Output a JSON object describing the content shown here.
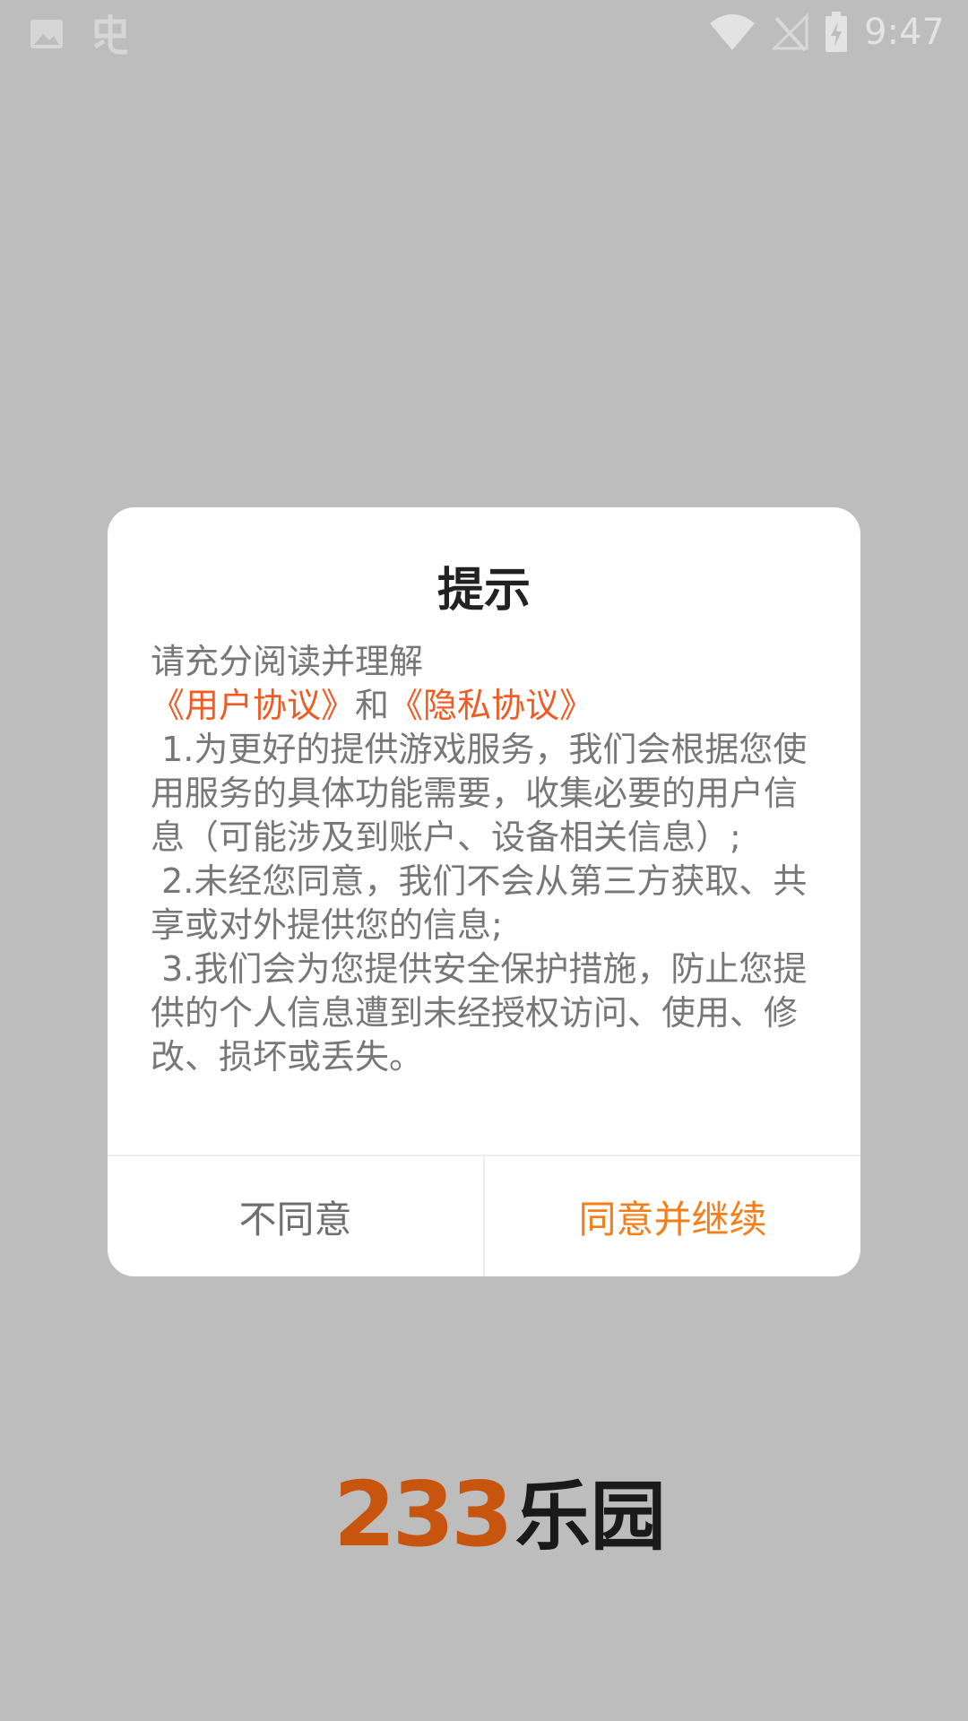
{
  "status_bar": {
    "time": "9:47",
    "icons_left": [
      "image-icon",
      "app-notification-icon"
    ],
    "icons_right": [
      "wifi-icon",
      "no-signal-icon",
      "battery-charging-icon"
    ]
  },
  "dialog": {
    "title": "提示",
    "intro": "请充分阅读并理解",
    "link_user": "《用户协议》",
    "link_and": "和",
    "link_privacy": "《隐私协议》",
    "items": [
      " 1.为更好的提供游戏服务，我们会根据您使用服务的具体功能需要，收集必要的用户信息（可能涉及到账户、设备相关信息）;",
      " 2.未经您同意，我们不会从第三方获取、共享或对外提供您的信息;",
      " 3.我们会为您提供安全保护措施，防止您提供的个人信息遭到未经授权访问、使用、修改、损坏或丢失。"
    ],
    "disagree_label": "不同意",
    "agree_label": "同意并继续"
  },
  "logo": {
    "number": "233",
    "name": "乐园"
  },
  "colors": {
    "background": "#bdbdbd",
    "link": "#f15a22",
    "agree": "#f47e1a",
    "logo_number": "#c8550e"
  }
}
